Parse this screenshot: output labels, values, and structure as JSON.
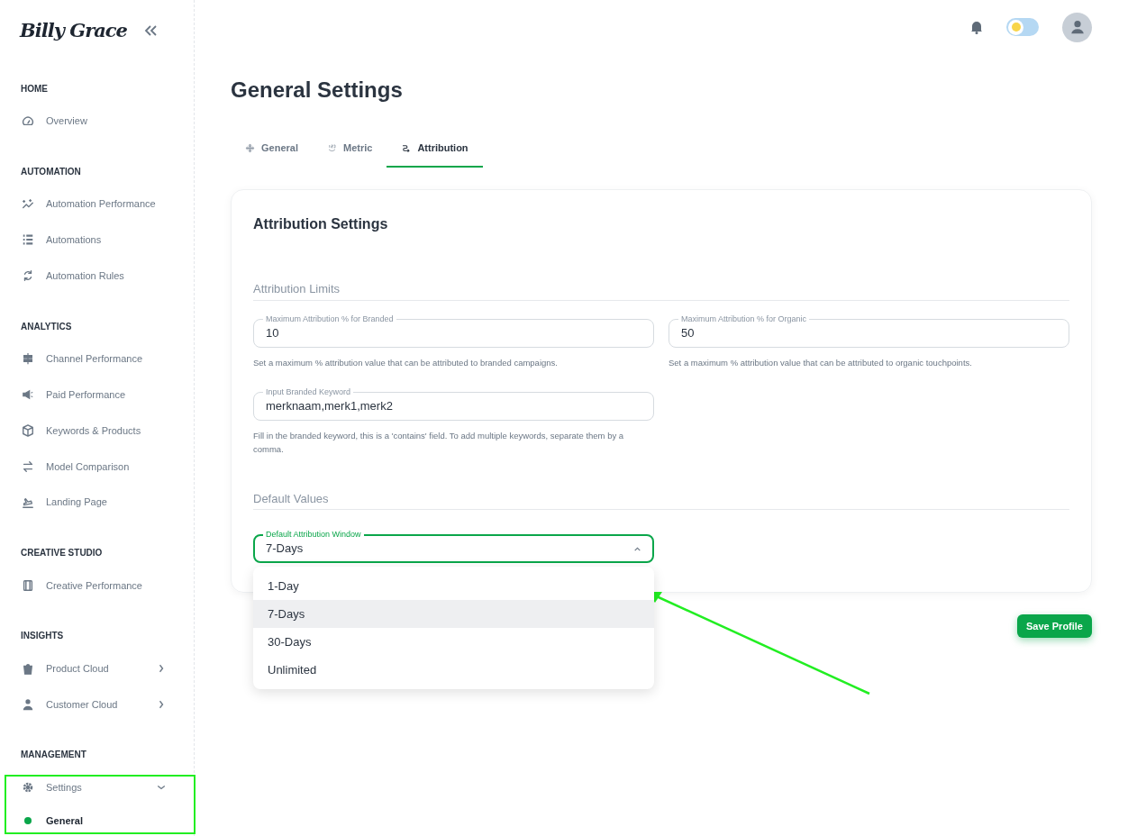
{
  "sidebar": {
    "logo": "Billy Grace",
    "sections": [
      {
        "title": "HOME",
        "items": [
          {
            "label": "Overview"
          }
        ]
      },
      {
        "title": "AUTOMATION",
        "items": [
          {
            "label": "Automation Performance"
          },
          {
            "label": "Automations"
          },
          {
            "label": "Automation Rules"
          }
        ]
      },
      {
        "title": "ANALYTICS",
        "items": [
          {
            "label": "Channel Performance"
          },
          {
            "label": "Paid Performance"
          },
          {
            "label": "Keywords & Products"
          },
          {
            "label": "Model Comparison"
          },
          {
            "label": "Landing Page"
          }
        ]
      },
      {
        "title": "CREATIVE STUDIO",
        "items": [
          {
            "label": "Creative Performance"
          }
        ]
      },
      {
        "title": "INSIGHTS",
        "items": [
          {
            "label": "Product Cloud",
            "expanded": false
          },
          {
            "label": "Customer Cloud",
            "expanded": false
          }
        ]
      },
      {
        "title": "MANAGEMENT",
        "items": [
          {
            "label": "Settings",
            "expanded": true,
            "children": [
              {
                "label": "General",
                "selected": true
              }
            ]
          }
        ]
      }
    ]
  },
  "header": {
    "theme_toggle": {
      "on": false
    }
  },
  "page_title": "General Settings",
  "tabs": [
    {
      "label": "General",
      "selected": false
    },
    {
      "label": "Metric",
      "selected": false
    },
    {
      "label": "Attribution",
      "selected": true
    }
  ],
  "card": {
    "title": "Attribution Settings",
    "limits": {
      "heading": "Attribution Limits",
      "fields": [
        {
          "label": "Maximum Attribution % for Branded",
          "value": "10",
          "help": "Set a maximum % attribution value that can be attributed to branded campaigns."
        },
        {
          "label": "Maximum Attribution % for Organic",
          "value": "50",
          "help": "Set a maximum % attribution value that can be attributed to organic touchpoints."
        },
        {
          "label": "Input Branded Keyword",
          "value": "merknaam,merk1,merk2",
          "help": "Fill in the branded keyword, this is a 'contains' field. To add multiple keywords, separate them by a comma."
        }
      ]
    },
    "defaults": {
      "heading": "Default Values",
      "select": {
        "label": "Default Attribution Window",
        "value": "7-Days",
        "expanded": true,
        "options": [
          {
            "label": "1-Day",
            "selected": false
          },
          {
            "label": "7-Days",
            "selected": true
          },
          {
            "label": "30-Days",
            "selected": false
          },
          {
            "label": "Unlimited",
            "selected": false
          }
        ]
      }
    }
  },
  "save_button": "Save Profile",
  "annotations": {
    "highlight_frame": true,
    "arrow": true
  }
}
